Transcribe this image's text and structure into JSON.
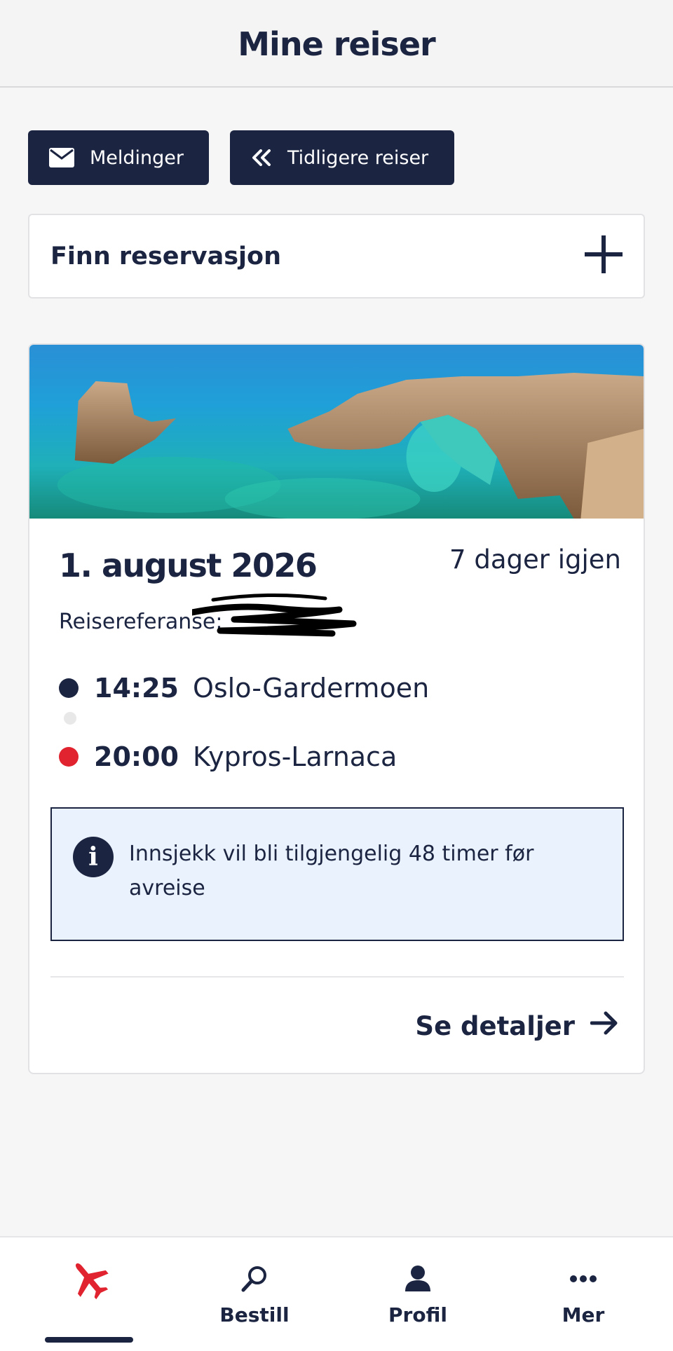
{
  "header": {
    "title": "Mine reiser"
  },
  "actions": {
    "messages_label": "Meldinger",
    "previous_trips_label": "Tidligere reiser"
  },
  "find_reservation": {
    "label": "Finn reservasjon"
  },
  "trip": {
    "date": "1. august 2026",
    "days_left": "7 dager igjen",
    "reference_label": "Reisereferanse:",
    "departure": {
      "time": "14:25",
      "place": "Oslo-Gardermoen",
      "dot_color": "#1b2440"
    },
    "arrival": {
      "time": "20:00",
      "place": "Kypros-Larnaca",
      "dot_color": "#e0232e"
    },
    "info_text": "Innsjekk vil bli tilgjengelig 48 timer før avreise",
    "details_label": "Se detaljer"
  },
  "tabbar": {
    "items": [
      {
        "label": "",
        "icon": "airplane-icon",
        "active": true
      },
      {
        "label": "Bestill",
        "icon": "search-icon"
      },
      {
        "label": "Profil",
        "icon": "person-icon"
      },
      {
        "label": "Mer",
        "icon": "more-icon"
      }
    ]
  },
  "colors": {
    "navy": "#1b2440",
    "accent_red": "#e0232e",
    "info_bg": "#eaf2fe"
  }
}
